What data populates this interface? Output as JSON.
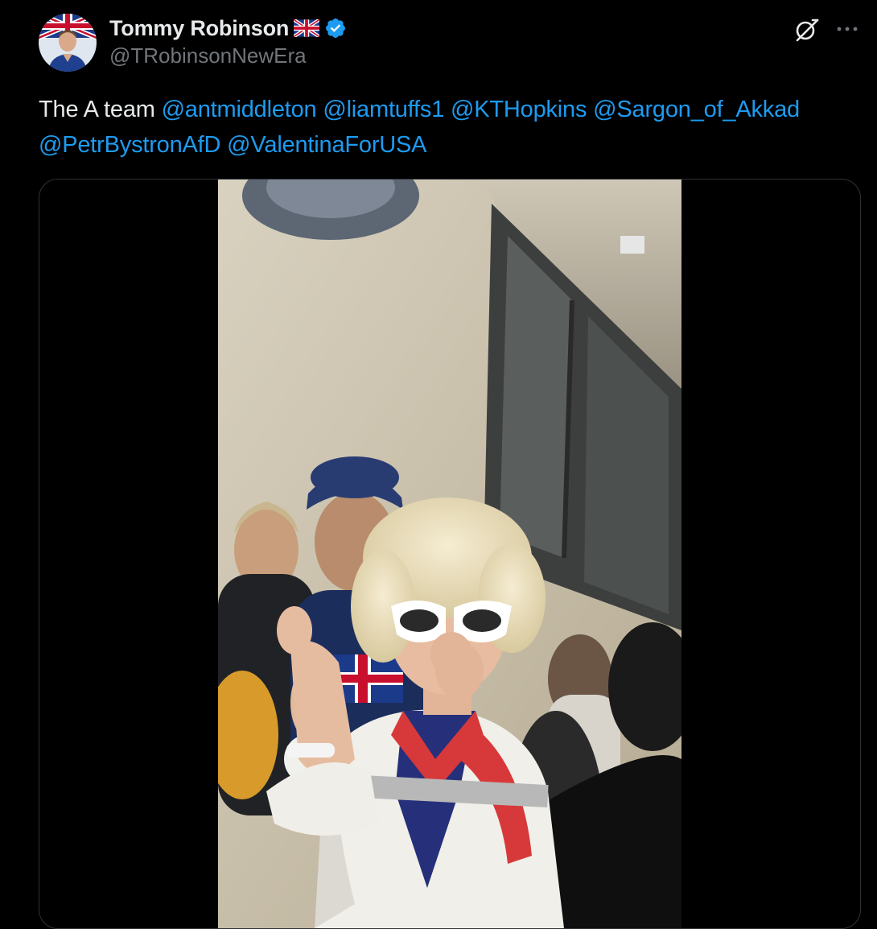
{
  "author": {
    "display_name": "Tommy Robinson",
    "flag": "uk-flag-icon",
    "verified": true,
    "handle": "@TRobinsonNewEra"
  },
  "tweet": {
    "text_prefix": "The A team",
    "mentions": [
      "@antmiddleton",
      "@liamtuffs1",
      "@KTHopkins",
      "@Sargon_of_Akkad",
      "@PetrBystronAfD",
      "@ValentinaForUSA"
    ]
  },
  "actions": {
    "grok_icon": "grok-icon",
    "more_icon": "more-options-icon"
  },
  "media": {
    "type": "video"
  },
  "colors": {
    "background": "#000000",
    "text": "#e7e9ea",
    "secondary_text": "#71767b",
    "link": "#1d9bf0",
    "verified": "#1d9bf0",
    "border": "#2f3336"
  }
}
